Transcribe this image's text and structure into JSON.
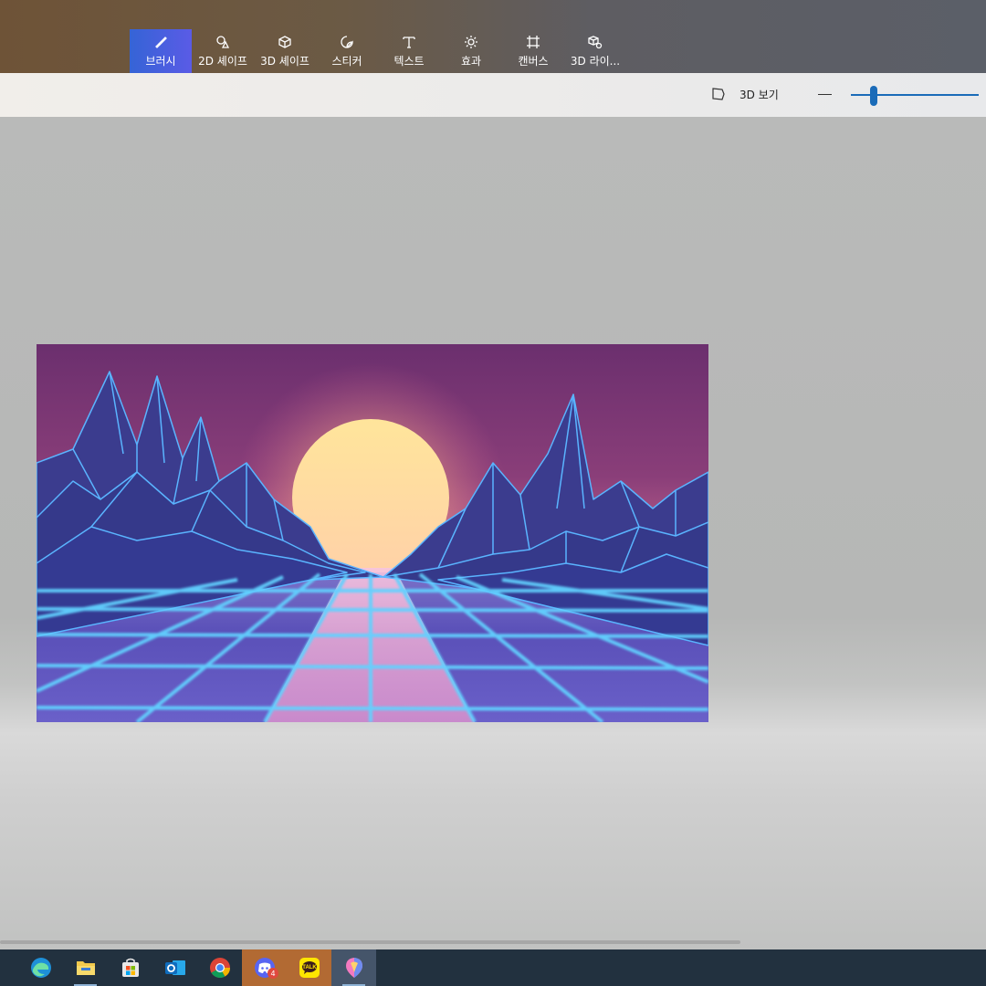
{
  "toolbar": {
    "tools": [
      {
        "label": "브러시",
        "icon": "brush-icon",
        "active": true
      },
      {
        "label": "2D 셰이프",
        "icon": "2d-shapes-icon"
      },
      {
        "label": "3D 셰이프",
        "icon": "3d-shapes-icon"
      },
      {
        "label": "스티커",
        "icon": "sticker-icon"
      },
      {
        "label": "텍스트",
        "icon": "text-icon"
      },
      {
        "label": "효과",
        "icon": "effects-icon"
      },
      {
        "label": "캔버스",
        "icon": "canvas-icon"
      },
      {
        "label": "3D 라이...",
        "icon": "3d-library-icon"
      }
    ],
    "accent": "#3564d6"
  },
  "viewbar": {
    "view_3d_label": "3D 보기",
    "zoom_level": 0.15,
    "slider_color": "#1a6bb8"
  },
  "canvas": {
    "image_description_icon": "synthwave-image"
  },
  "taskbar": {
    "apps": [
      {
        "icon": "edge-icon"
      },
      {
        "icon": "file-explorer-icon"
      },
      {
        "icon": "microsoft-store-icon"
      },
      {
        "icon": "outlook-icon"
      },
      {
        "icon": "chrome-icon"
      },
      {
        "icon": "discord-icon",
        "badge": "4"
      },
      {
        "icon": "kakaotalk-icon",
        "text": "TALK"
      },
      {
        "icon": "paint-3d-icon"
      }
    ]
  }
}
